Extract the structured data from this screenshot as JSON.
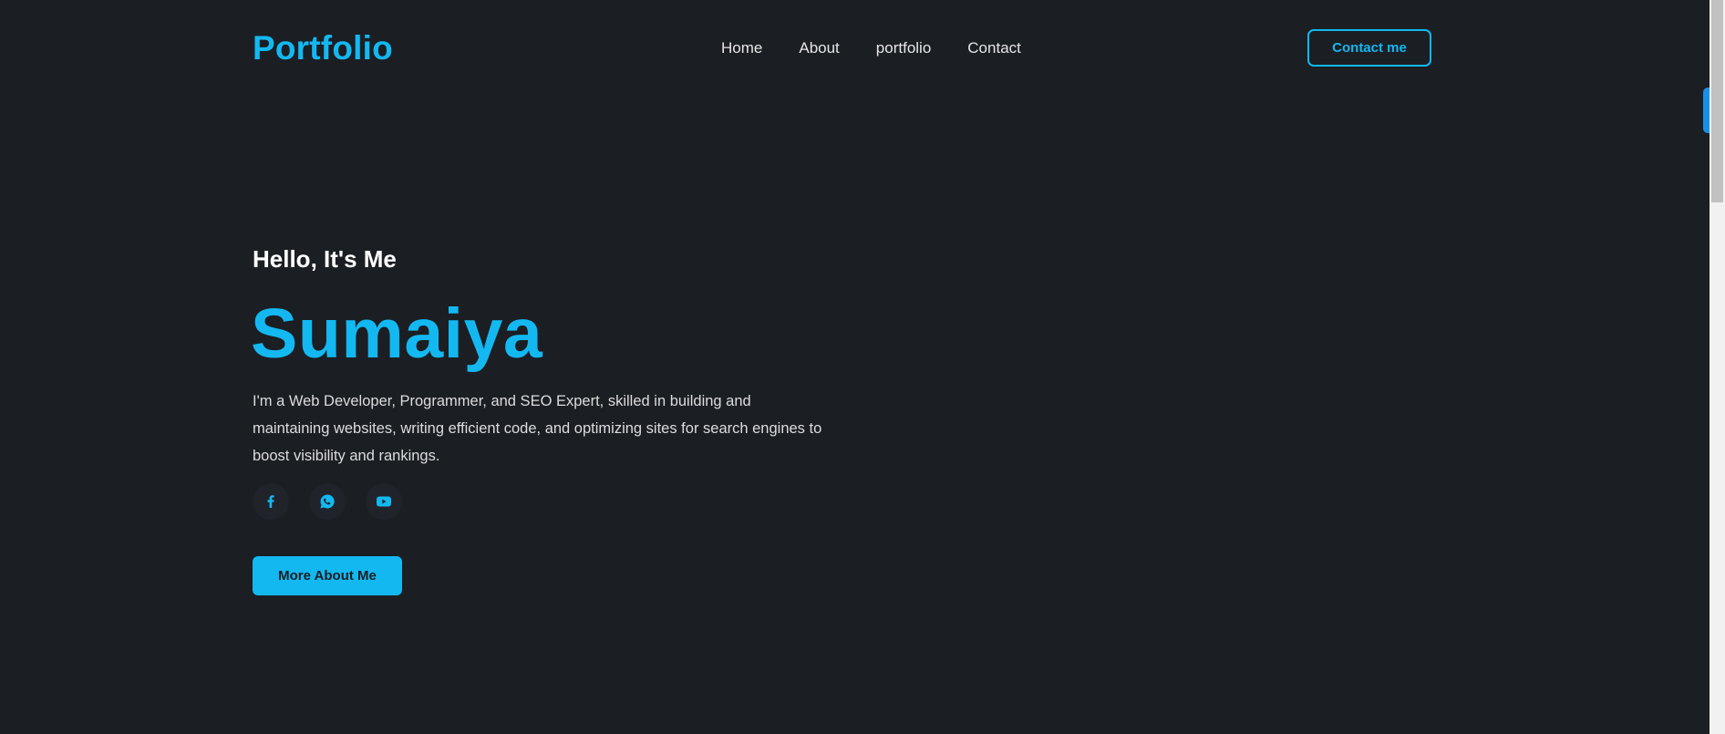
{
  "header": {
    "logo": "Portfolio",
    "nav": [
      "Home",
      "About",
      "portfolio",
      "Contact"
    ],
    "contact_button": "Contact me"
  },
  "hero": {
    "greeting": "Hello, It's Me",
    "name": "Sumaiya",
    "description": "I'm a Web Developer, Programmer, and SEO Expert, skilled in building and maintaining websites, writing efficient code, and optimizing sites for search engines to boost visibility and rankings.",
    "socials": [
      {
        "icon": "facebook-icon"
      },
      {
        "icon": "whatsapp-icon"
      },
      {
        "icon": "youtube-icon"
      }
    ],
    "more_button": "More About Me"
  },
  "colors": {
    "background": "#1b1e23",
    "accent": "#13b8f1",
    "text": "#dcdcdc"
  }
}
